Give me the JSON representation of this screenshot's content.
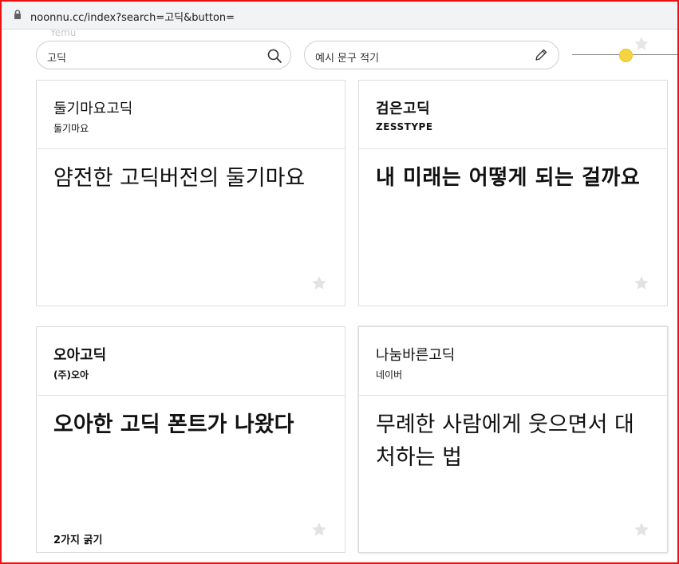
{
  "browser": {
    "url": "noonnu.cc/index?search=고딕&button="
  },
  "ghost": {
    "left_text": "Yemu"
  },
  "toolbar": {
    "search_value": "고딕",
    "sample_placeholder": "예시 문구 적기",
    "accent_color": "#f5d442"
  },
  "fonts": [
    {
      "name": "둘기마요고딕",
      "maker": "둘기마요",
      "sample": "얌전한 고딕버전의 둘기마요",
      "weights": ""
    },
    {
      "name": "검은고딕",
      "maker": "ZESSTYPE",
      "sample": "내 미래는 어떻게 되는 걸까요",
      "weights": ""
    },
    {
      "name": "오아고딕",
      "maker": "(주)오아",
      "sample": "오아한 고딕 폰트가 나왔다",
      "weights": "2가지 굵기"
    },
    {
      "name": "나눔바른고딕",
      "maker": "네이버",
      "sample": "무례한 사람에게 웃으면서 대처하는 법",
      "weights": ""
    }
  ],
  "icons": {
    "lock": "lock-icon",
    "search": "search-icon",
    "pencil": "pencil-icon",
    "star": "star-icon"
  }
}
